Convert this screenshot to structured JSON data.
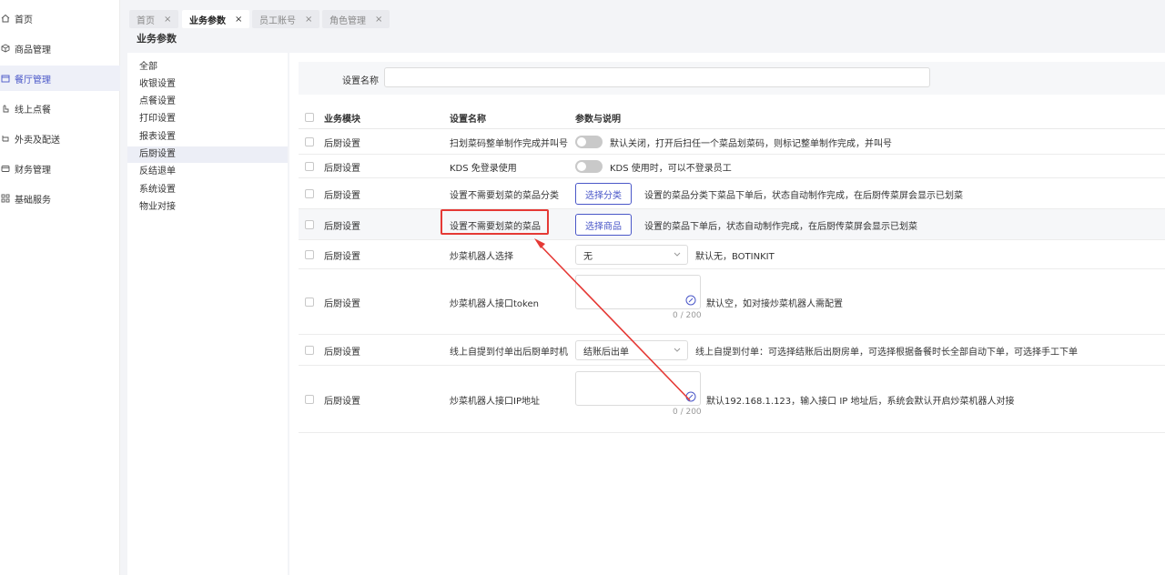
{
  "sidebar": {
    "items": [
      {
        "label": "首页",
        "icon": "home-icon"
      },
      {
        "label": "商品管理",
        "icon": "box-icon"
      },
      {
        "label": "餐厅管理",
        "icon": "store-icon",
        "active": true
      },
      {
        "label": "线上点餐",
        "icon": "hand-icon"
      },
      {
        "label": "外卖及配送",
        "icon": "delivery-icon"
      },
      {
        "label": "财务管理",
        "icon": "wallet-icon"
      },
      {
        "label": "基础服务",
        "icon": "grid-icon"
      }
    ]
  },
  "tabs": [
    {
      "label": "首页",
      "close": "×"
    },
    {
      "label": "业务参数",
      "close": "×",
      "active": true
    },
    {
      "label": "员工账号",
      "close": "×"
    },
    {
      "label": "角色管理",
      "close": "×"
    }
  ],
  "page_title": "业务参数",
  "categories": [
    "全部",
    "收银设置",
    "点餐设置",
    "打印设置",
    "报表设置",
    "后厨设置",
    "反结退单",
    "系统设置",
    "物业对接"
  ],
  "search": {
    "label": "设置名称",
    "placeholder": "",
    "value": ""
  },
  "table": {
    "headers": {
      "module": "业务模块",
      "name": "设置名称",
      "params": "参数与说明"
    },
    "rows": [
      {
        "module": "后厨设置",
        "name": "扫划菜码整单制作完成并叫号",
        "control": "toggle",
        "desc": "默认关闭，打开后扫任一个菜品划菜码，则标记整单制作完成，并叫号"
      },
      {
        "module": "后厨设置",
        "name": "KDS 免登录使用",
        "control": "toggle",
        "desc": "KDS 使用时，可以不登录员工"
      },
      {
        "module": "后厨设置",
        "name": "设置不需要划菜的菜品分类",
        "control": "button",
        "button_label": "选择分类",
        "desc": "设置的菜品分类下菜品下单后，状态自动制作完成，在后厨传菜屏会显示已划菜"
      },
      {
        "module": "后厨设置",
        "name": "设置不需要划菜的菜品",
        "control": "button",
        "button_label": "选择商品",
        "desc": "设置的菜品下单后，状态自动制作完成，在后厨传菜屏会显示已划菜"
      },
      {
        "module": "后厨设置",
        "name": "炒菜机器人选择",
        "control": "select",
        "select_value": "无",
        "desc": "默认无，BOTINKIT"
      },
      {
        "module": "后厨设置",
        "name": "炒菜机器人接口token",
        "control": "textarea",
        "count": "0 / 200",
        "desc": "默认空，如对接炒菜机器人需配置"
      },
      {
        "module": "后厨设置",
        "name": "线上自提到付单出后厨单时机",
        "control": "select",
        "select_value": "结账后出单",
        "desc": "线上自提到付单：可选择结账后出厨房单，可选择根据备餐时长全部自动下单，可选择手工下单"
      },
      {
        "module": "后厨设置",
        "name": "炒菜机器人接口IP地址",
        "control": "textarea",
        "count": "0 / 200",
        "desc": "默认192.168.1.123，输入接口 IP 地址后，系统会默认开启炒菜机器人对接"
      }
    ]
  },
  "colors": {
    "accent": "#4a57c8",
    "annotation": "#e53935"
  }
}
